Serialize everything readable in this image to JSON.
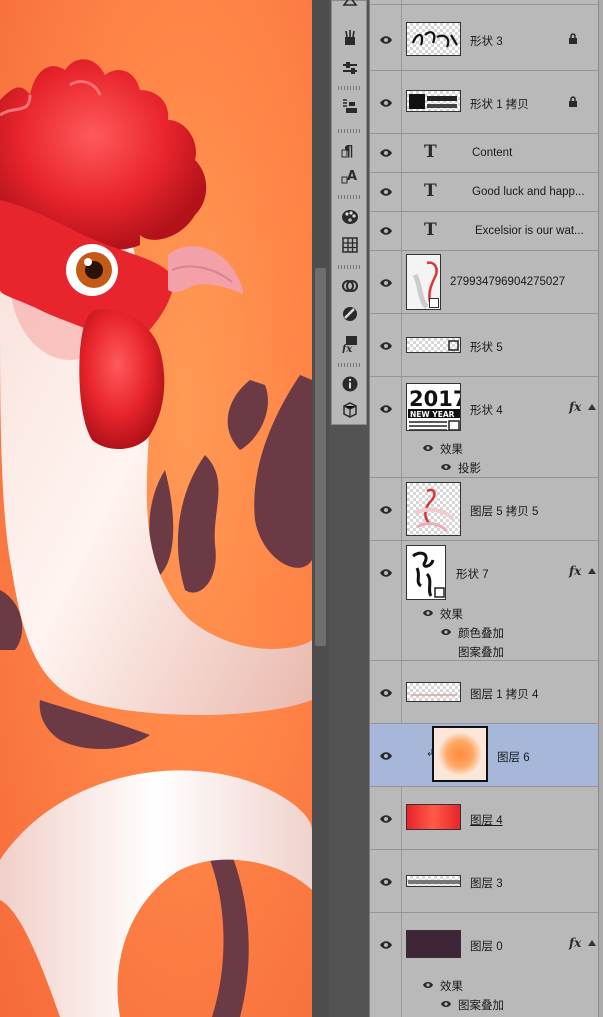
{
  "layers": [
    {
      "name": "形状 3",
      "kind": "shape",
      "locked": true
    },
    {
      "name": "形状 1 拷贝",
      "kind": "shape",
      "locked": true
    },
    {
      "name": "Content",
      "kind": "text"
    },
    {
      "name": "Good luck and happ...",
      "kind": "text"
    },
    {
      "name": "Excelsior is our wat...",
      "kind": "text"
    },
    {
      "name": "279934796904275027",
      "kind": "smart-object"
    },
    {
      "name": "形状 5",
      "kind": "shape"
    },
    {
      "name": "形状 4",
      "kind": "shape",
      "fx": true,
      "effects_label": "效果",
      "effects": [
        "投影"
      ]
    },
    {
      "name": "图层 5 拷贝 5",
      "kind": "pixel"
    },
    {
      "name": "形状 7",
      "kind": "shape",
      "fx": true,
      "effects_label": "效果",
      "effects": [
        "颜色叠加",
        "图案叠加"
      ]
    },
    {
      "name": "图层 1 拷贝 4",
      "kind": "pixel"
    },
    {
      "name": "图层 6",
      "kind": "pixel",
      "selected": true,
      "clipped": true
    },
    {
      "name": "图层 4",
      "kind": "pixel",
      "underlined": true
    },
    {
      "name": "图层 3",
      "kind": "pixel"
    },
    {
      "name": "图层 0",
      "kind": "pixel",
      "fx": true,
      "effects_label": "效果",
      "effects": [
        "图案叠加"
      ]
    }
  ],
  "fx_badge": "fx",
  "thumb_text": {
    "year": "2017",
    "new_year": "NEW YEAR"
  },
  "tools": [
    "brush-presets-icon",
    "tool-presets-icon",
    "clone-source-icon",
    "paragraph-icon",
    "character-icon",
    "swatches-icon",
    "grid-icon",
    "libraries-icon",
    "adjustments-icon",
    "properties-icon",
    "info-icon",
    "3d-icon"
  ],
  "colors": {
    "canvas_bg": "#ff8547",
    "panel_bg": "#b9b9b9",
    "selected_row": "#a6b7d9",
    "comb_red": "#e8242c",
    "wing_shadow": "#6b3a44"
  }
}
